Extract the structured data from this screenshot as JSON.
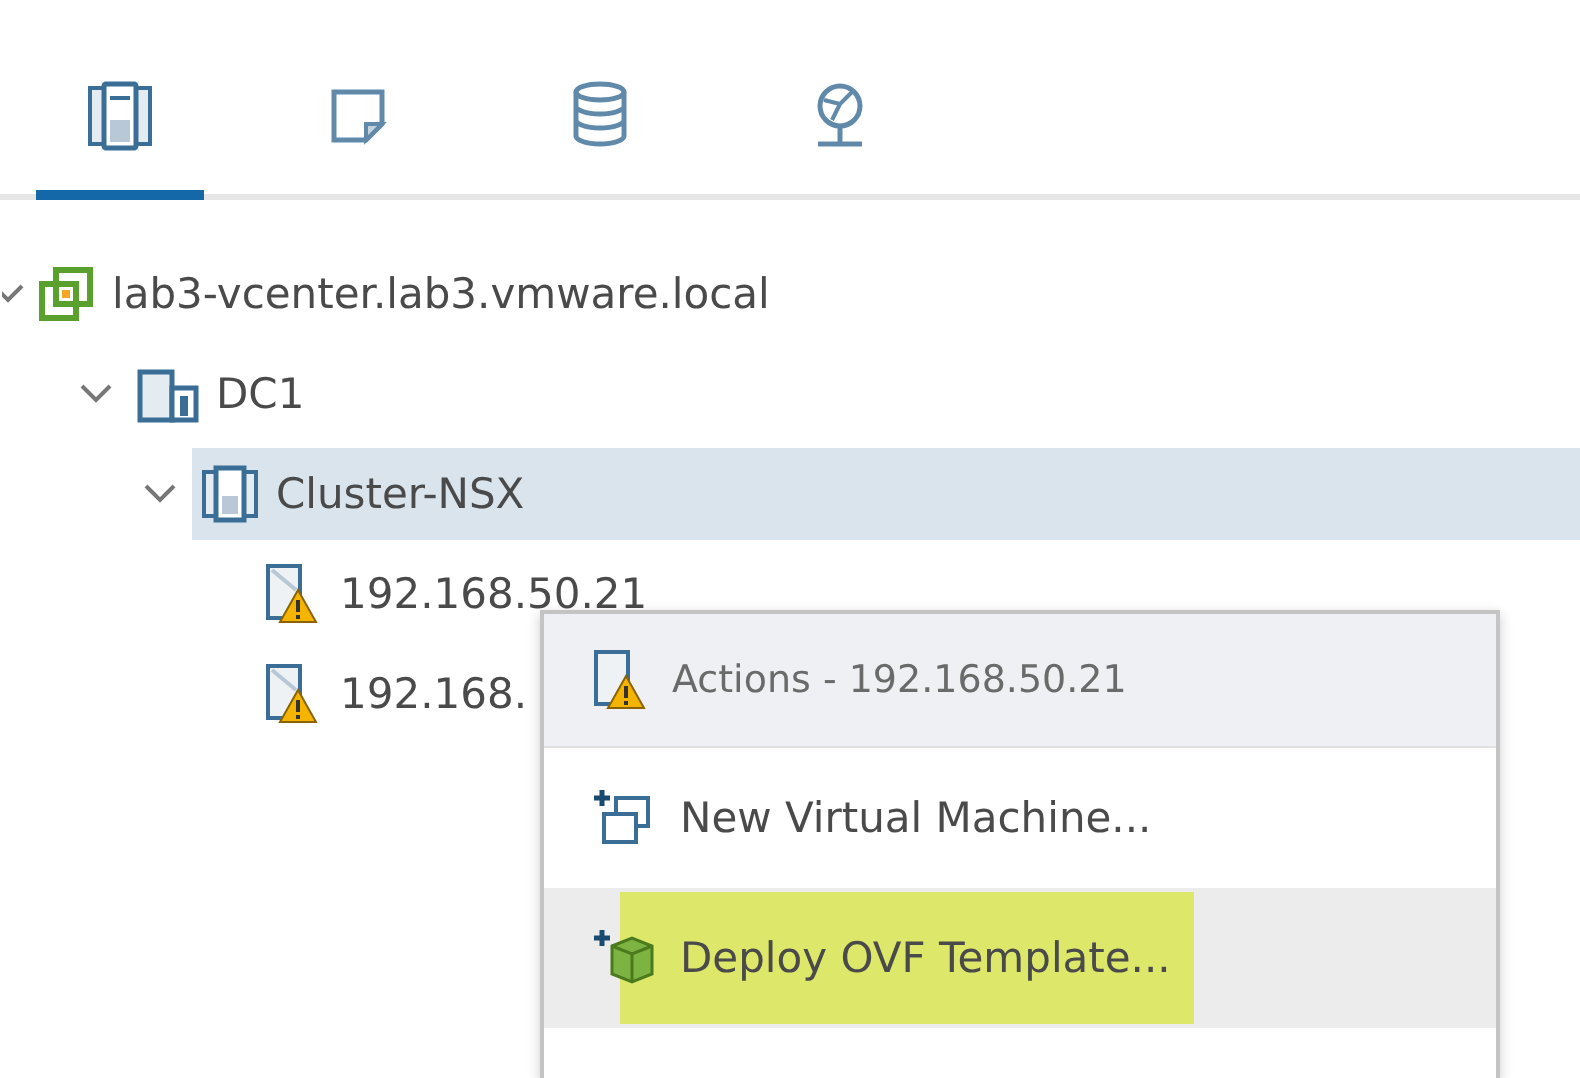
{
  "tabs": [
    {
      "kind": "hosts-clusters",
      "selected": true
    },
    {
      "kind": "vms-templates",
      "selected": false
    },
    {
      "kind": "storage",
      "selected": false
    },
    {
      "kind": "networking",
      "selected": false
    }
  ],
  "tree": [
    {
      "kind": "vcenter",
      "label": "lab3-vcenter.lab3.vmware.local",
      "expanded": true,
      "selected": false,
      "children": [
        {
          "kind": "datacenter",
          "label": "DC1",
          "expanded": true,
          "selected": false,
          "children": [
            {
              "kind": "cluster",
              "label": "Cluster-NSX",
              "expanded": true,
              "selected": true,
              "children": [
                {
                  "kind": "host",
                  "label": "192.168.50.21",
                  "expanded": false,
                  "selected": false,
                  "warning": true
                },
                {
                  "kind": "host",
                  "label": "192.168.",
                  "expanded": false,
                  "selected": false,
                  "warning": true
                }
              ]
            }
          ]
        }
      ]
    }
  ],
  "context_menu": {
    "title": "Actions - 192.168.50.21",
    "title_warning": true,
    "items": [
      {
        "kind": "new-vm",
        "label": "New Virtual Machine...",
        "hovered": false,
        "highlighted": false
      },
      {
        "kind": "deploy-ovf",
        "label": "Deploy OVF Template...",
        "hovered": true,
        "highlighted": true
      }
    ]
  }
}
